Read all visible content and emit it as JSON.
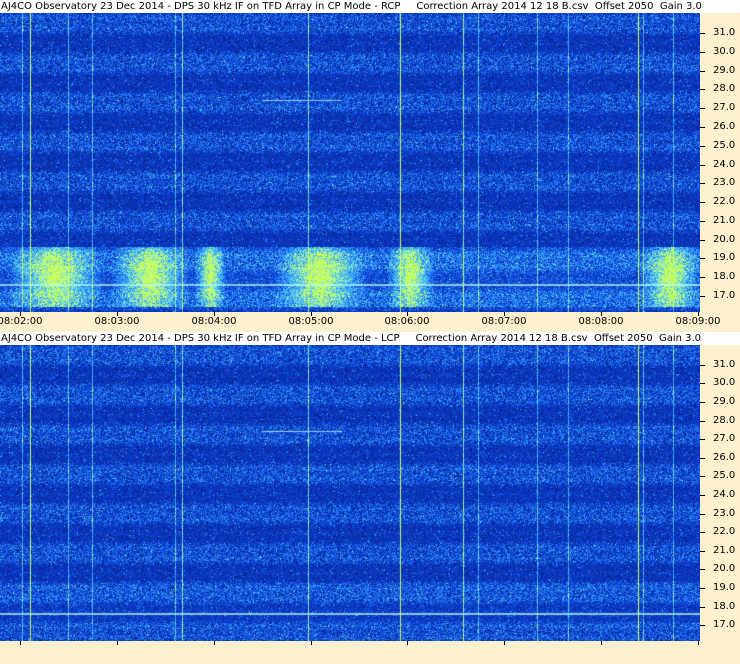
{
  "top_panel": {
    "title": "AJ4CO Observatory 23 Dec 2014 - DPS 30 kHz IF on TFD Array in CP Mode - RCP     Correction Array 2014 12 18 B.csv  Offset 2050  Gain 3.0"
  },
  "bottom_panel": {
    "title": "AJ4CO Observatory 23 Dec 2014 - DPS 30 kHz IF on TFD Array in CP Mode - LCP     Correction Array 2014 12 18 B.csv  Offset 2050  Gain 3.0"
  },
  "y_axis_labels": [
    "31.0",
    "30.0",
    "29.0",
    "28.0",
    "27.0",
    "26.0",
    "25.0",
    "24.0",
    "23.0",
    "22.0",
    "21.0",
    "20.0",
    "19.0",
    "18.0",
    "17.0"
  ],
  "x_axis_labels": [
    "08:02:00",
    "08:03:00",
    "08:04:00",
    "08:05:00",
    "08:06:00",
    "08:07:00",
    "08:08:00",
    "08:09:00"
  ],
  "colors": {
    "background": "#fdf0cf",
    "spectrogram_low": "#0a1f8f",
    "spectrogram_mid": "#2e6bff",
    "spectrogram_high": "#7fffd0",
    "burst": "#c8ff40"
  }
}
